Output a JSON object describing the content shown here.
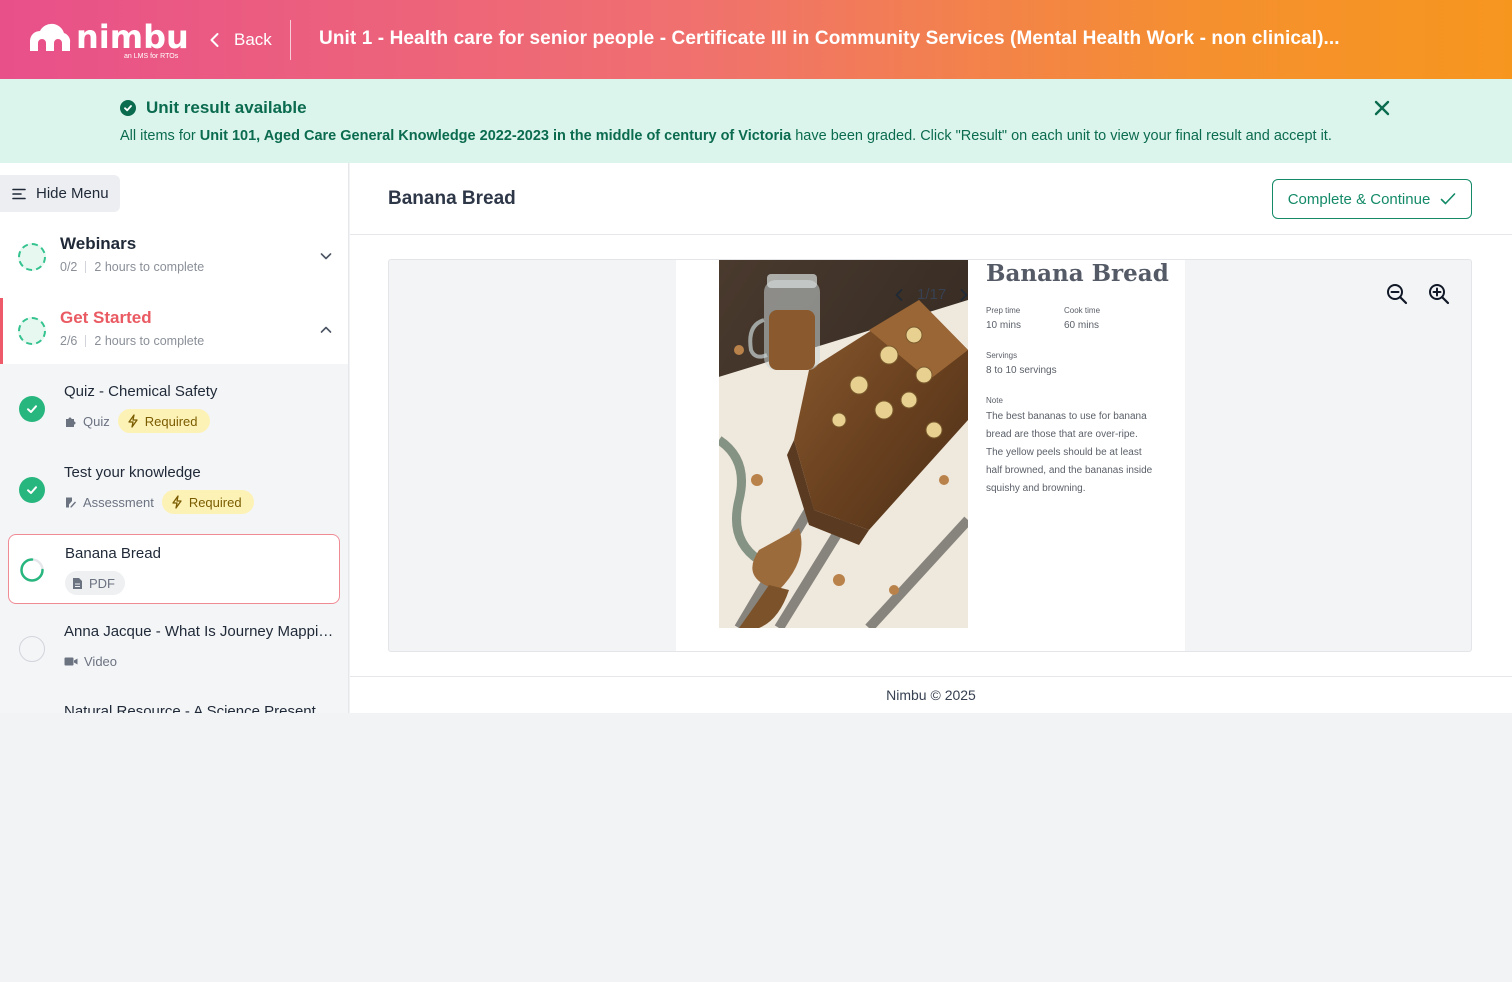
{
  "header": {
    "logo_text": "nimbu",
    "logo_tagline": "an LMS for RTOs",
    "back_label": "Back",
    "course_title": "Unit 1 - Health care for senior people - Certificate III in Community Services (Mental Health Work - non clinical)..."
  },
  "banner": {
    "title": "Unit result available",
    "text_before": "All items for ",
    "text_bold": "Unit 101, Aged Care General Knowledge 2022-2023 in the middle of century of Victoria",
    "text_after": " have been graded. Click \"Result\" on each unit to view your final result and accept it."
  },
  "sidebar": {
    "hide_menu_label": "Hide Menu",
    "sections": [
      {
        "title": "Webinars",
        "progress": "0/2",
        "duration": "2 hours to complete",
        "expanded": false
      },
      {
        "title": "Get Started",
        "progress": "2/6",
        "duration": "2 hours to complete",
        "expanded": true
      }
    ],
    "items": [
      {
        "title": "Quiz - Chemical Safety",
        "type": "Quiz",
        "required": "Required",
        "status": "done",
        "icon": "puzzle-icon"
      },
      {
        "title": "Test your knowledge",
        "type": "Assessment",
        "required": "Required",
        "status": "done",
        "icon": "edit-icon"
      },
      {
        "title": "Banana Bread",
        "type": "PDF",
        "status": "in-progress",
        "icon": "document-icon"
      },
      {
        "title": "Anna Jacque - What Is Journey Mappin...",
        "type": "Video",
        "status": "not-started",
        "icon": "video-icon"
      },
      {
        "title": "Natural Resource - A Science Presenta...",
        "status": "not-started"
      }
    ]
  },
  "main": {
    "title": "Banana Bread",
    "complete_label": "Complete & Continue",
    "pager": {
      "current": 1,
      "total": 17,
      "text": "1/17"
    },
    "footer": "Nimbu © 2025"
  },
  "pdf_page": {
    "recipe_title": "Banana Bread",
    "prep_label": "Prep time",
    "prep_value": "10 mins",
    "cook_label": "Cook time",
    "cook_value": "60 mins",
    "servings_label": "Servings",
    "servings_value": "8 to 10 servings",
    "note_label": "Note",
    "note_text": "The best bananas to use for banana bread are those that are over-ripe. The yellow peels should be at least half browned, and the bananas inside squishy and browning."
  },
  "colors": {
    "accent_green": "#148a68",
    "active_red": "#ea5a62",
    "banner_bg": "#dcf5ec",
    "required_bg": "#fdf2b6"
  }
}
